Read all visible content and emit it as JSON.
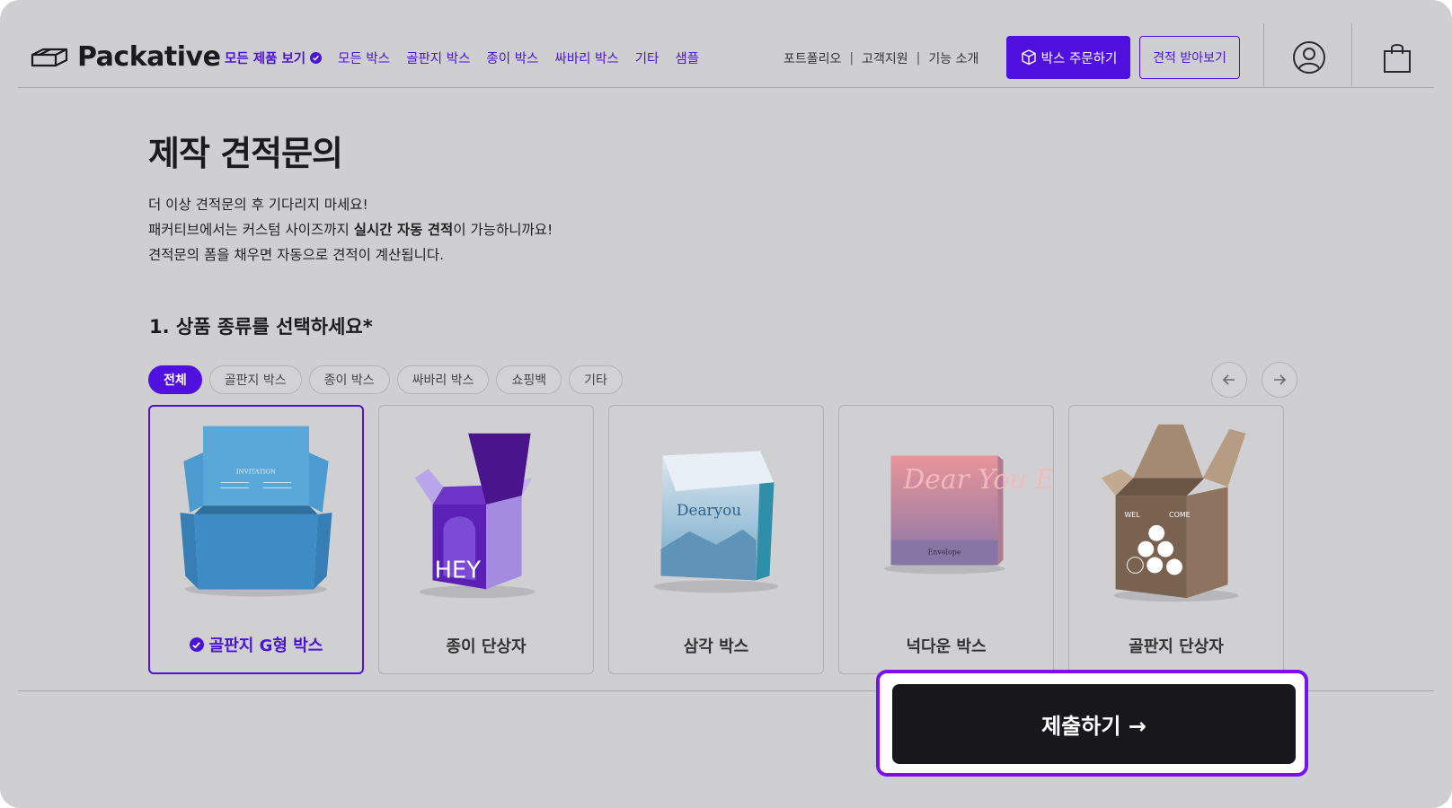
{
  "header": {
    "logo_text": "Packative",
    "nav": [
      "모든 제품 보기",
      "모든 박스",
      "골판지 박스",
      "종이 박스",
      "싸바리 박스",
      "기타",
      "샘플"
    ],
    "util_links": [
      "포트폴리오",
      "고객지원",
      "기능 소개"
    ],
    "order_button": "박스 주문하기",
    "quote_button": "견적 받아보기"
  },
  "main": {
    "title": "제작 견적문의",
    "intro_line1": "더 이상 견적문의 후 기다리지 마세요!",
    "intro_line2_pre": "패커티브에서는 커스텀 사이즈까지 ",
    "intro_line2_bold": "실시간 자동 견적",
    "intro_line2_post": "이 가능하니까요!",
    "intro_line3": "견적문의 폼을 채우면 자동으로 견적이 계산됩니다.",
    "section_title": "1. 상품 종류를 선택하세요*",
    "filters": [
      "전체",
      "골판지 박스",
      "종이 박스",
      "싸바리 박스",
      "쇼핑백",
      "기타"
    ],
    "active_filter": "전체",
    "products": [
      {
        "label": "골판지 G형 박스",
        "selected": true
      },
      {
        "label": "종이 단상자",
        "selected": false
      },
      {
        "label": "삼각 박스",
        "selected": false
      },
      {
        "label": "넉다운 박스",
        "selected": false
      },
      {
        "label": "골판지 단상자",
        "selected": false
      }
    ],
    "product_print": {
      "invitation": "INVITATION",
      "hey": "HEY",
      "dearyou": "Dearyou",
      "envelope": "Envelope",
      "dear_you_envelope": "Dear You Envelope",
      "wel": "WEL",
      "come": "COME"
    },
    "submit_label": "제출하기 →"
  },
  "colors": {
    "brand": "#5010e0",
    "brand_text": "#4a14d6",
    "submit_bg": "#17171c",
    "highlight": "#7a10f0"
  },
  "icons": [
    "logo-box-icon",
    "check-circle-icon",
    "box-icon",
    "user-icon",
    "shopping-bag-icon",
    "arrow-left-icon",
    "arrow-right-icon"
  ]
}
